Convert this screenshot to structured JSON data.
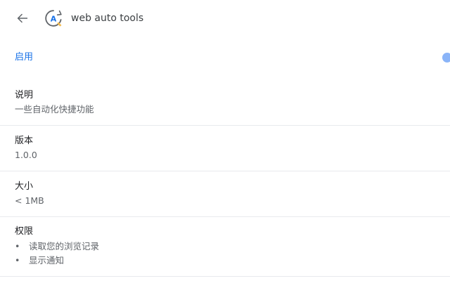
{
  "header": {
    "title": "web auto tools",
    "back_icon": "arrow-left-icon",
    "extension_icon": "extension-logo-icon",
    "extension_icon_letter": "A"
  },
  "enable": {
    "label": "启用",
    "toggle_on": true
  },
  "sections": {
    "description": {
      "title": "说明",
      "value": "一些自动化快捷功能"
    },
    "version": {
      "title": "版本",
      "value": "1.0.0"
    },
    "size": {
      "title": "大小",
      "value": "< 1MB"
    },
    "permissions": {
      "title": "权限",
      "items": [
        "读取您的浏览记录",
        "显示通知"
      ],
      "bullet": "•"
    }
  },
  "colors": {
    "accent": "#1a73e8",
    "toggle_knob": "#8ab4f8",
    "divider": "#e8eaed"
  }
}
